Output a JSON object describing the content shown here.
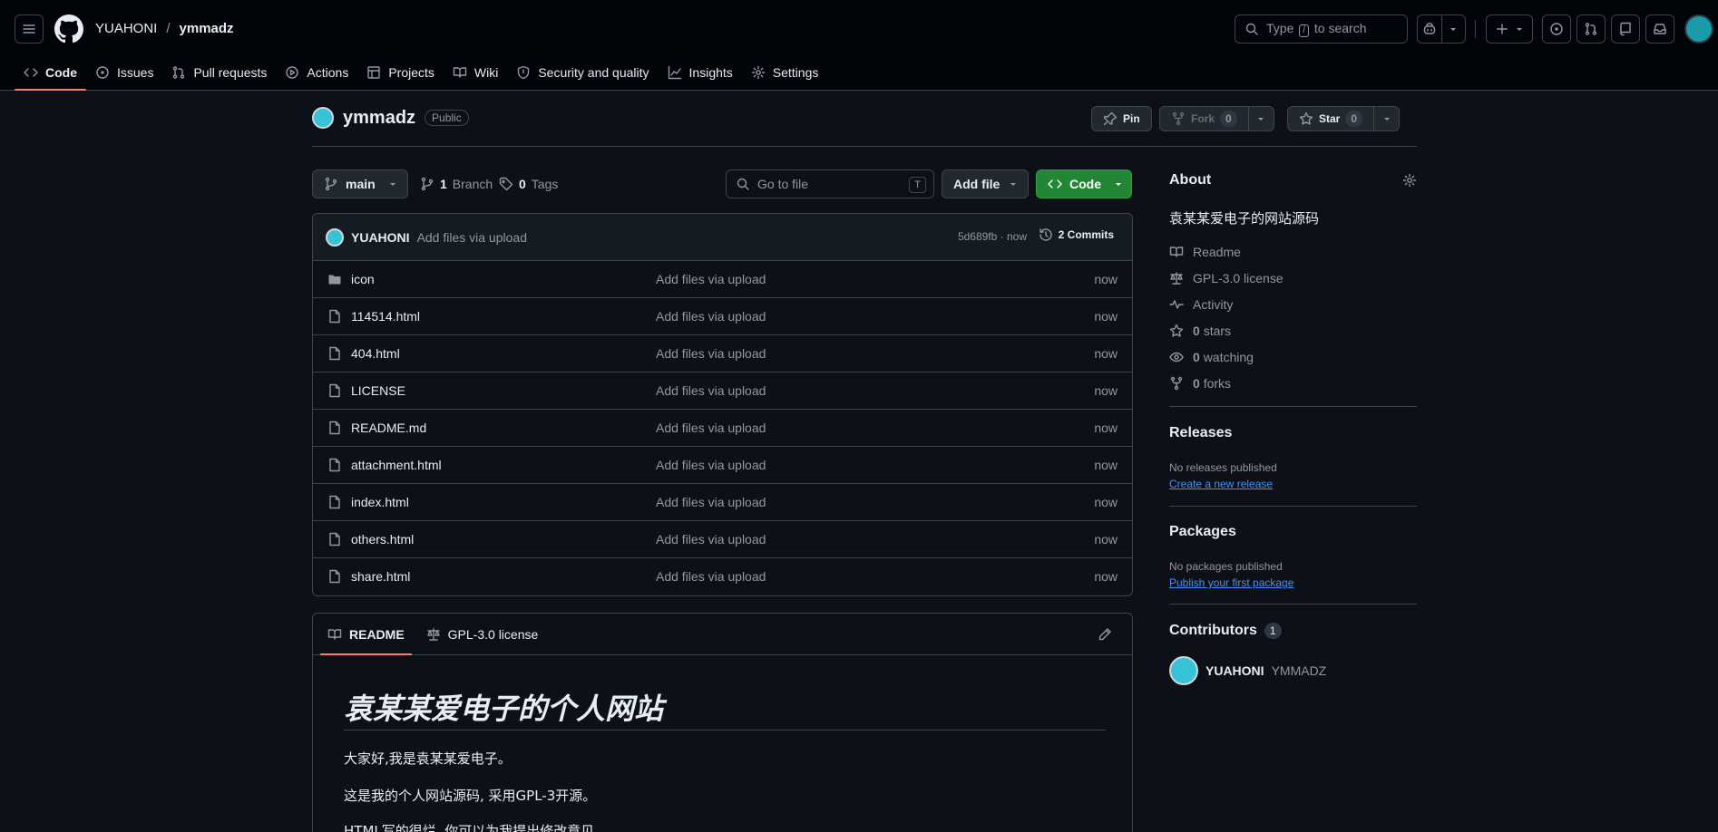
{
  "header": {
    "owner": "YUAHONI",
    "separator": "/",
    "repo": "ymmadz",
    "search_prefix": "Type",
    "search_key": "/",
    "search_suffix": "to search"
  },
  "nav": {
    "tabs": [
      {
        "label": "Code"
      },
      {
        "label": "Issues"
      },
      {
        "label": "Pull requests"
      },
      {
        "label": "Actions"
      },
      {
        "label": "Projects"
      },
      {
        "label": "Wiki"
      },
      {
        "label": "Security and quality"
      },
      {
        "label": "Insights"
      },
      {
        "label": "Settings"
      }
    ]
  },
  "repo": {
    "name": "ymmadz",
    "visibility": "Public",
    "pin_label": "Pin",
    "fork_label": "Fork",
    "fork_count": "0",
    "star_label": "Star",
    "star_count": "0"
  },
  "branchbar": {
    "branch": "main",
    "branch_count": "1",
    "branch_label": "Branch",
    "tag_count": "0",
    "tag_label": "Tags",
    "goto_placeholder": "Go to file",
    "goto_key": "T",
    "add_file": "Add file",
    "code": "Code"
  },
  "commit": {
    "author": "YUAHONI",
    "message": "Add files via upload",
    "meta": "5d689fb · now",
    "commits_label": "2 Commits"
  },
  "files": [
    {
      "name": "icon",
      "type": "dir",
      "message": "Add files via upload",
      "time": "now"
    },
    {
      "name": "114514.html",
      "type": "file",
      "message": "Add files via upload",
      "time": "now"
    },
    {
      "name": "404.html",
      "type": "file",
      "message": "Add files via upload",
      "time": "now"
    },
    {
      "name": "LICENSE",
      "type": "file",
      "message": "Add files via upload",
      "time": "now"
    },
    {
      "name": "README.md",
      "type": "file",
      "message": "Add files via upload",
      "time": "now"
    },
    {
      "name": "attachment.html",
      "type": "file",
      "message": "Add files via upload",
      "time": "now"
    },
    {
      "name": "index.html",
      "type": "file",
      "message": "Add files via upload",
      "time": "now"
    },
    {
      "name": "others.html",
      "type": "file",
      "message": "Add files via upload",
      "time": "now"
    },
    {
      "name": "share.html",
      "type": "file",
      "message": "Add files via upload",
      "time": "now"
    }
  ],
  "readme": {
    "tab_readme": "README",
    "tab_license": "GPL-3.0 license",
    "heading": "袁某某爱电子的个人网站",
    "para1": "大家好,我是袁某某爱电子。",
    "para2": "这是我的个人网站源码, 采用GPL-3开源。",
    "para3": "HTML写的很烂, 你可以为我提出修改意见。"
  },
  "sidebar": {
    "about_title": "About",
    "description": "袁某某爱电子的网站源码",
    "links": [
      {
        "icon": "book-icon",
        "text": "Readme"
      },
      {
        "icon": "law-icon",
        "text": "GPL-3.0 license"
      },
      {
        "icon": "pulse-icon",
        "text": "Activity"
      },
      {
        "icon": "star-icon",
        "count": "0",
        "text": "stars"
      },
      {
        "icon": "eye-icon",
        "count": "0",
        "text": "watching"
      },
      {
        "icon": "fork-icon",
        "count": "0",
        "text": "forks"
      }
    ],
    "releases_title": "Releases",
    "releases_empty": "No releases published",
    "releases_link": "Create a new release",
    "packages_title": "Packages",
    "packages_empty": "No packages published",
    "packages_link": "Publish your first package",
    "contributors_title": "Contributors",
    "contributors_count": "1",
    "contributor_name": "YUAHONI",
    "contributor_login": "YMMADZ"
  },
  "colors": {
    "accent_green": "#238636",
    "tab_underline": "#f78166",
    "link_blue": "#4493f8",
    "bg": "#0d1117"
  }
}
